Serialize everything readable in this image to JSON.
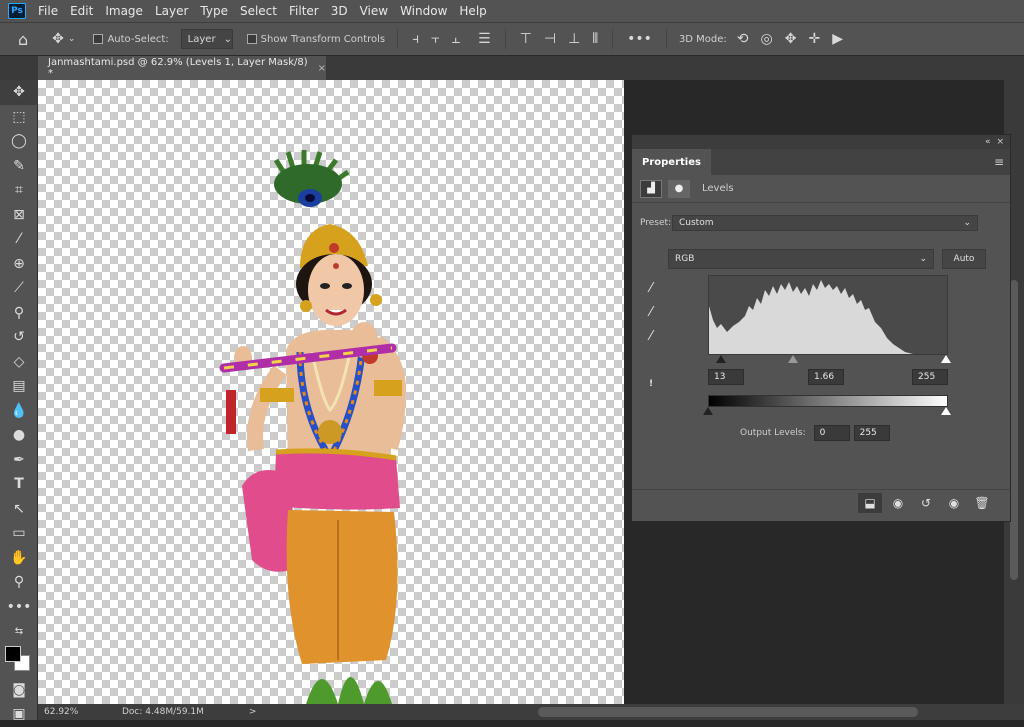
{
  "app": {
    "logo": "Ps"
  },
  "menu": [
    "File",
    "Edit",
    "Image",
    "Layer",
    "Type",
    "Select",
    "Filter",
    "3D",
    "View",
    "Window",
    "Help"
  ],
  "options": {
    "auto_select_label": "Auto-Select:",
    "auto_select_value": "Layer",
    "transform_label": "Show Transform Controls",
    "mode_label": "3D Mode:",
    "more": "•••"
  },
  "document": {
    "tab_title": "Janmashtami.psd @ 62.9% (Levels 1, Layer Mask/8) *",
    "close": "×"
  },
  "status": {
    "zoom": "62.92%",
    "doc": "Doc: 4.48M/59.1M",
    "arrow": ">"
  },
  "properties": {
    "tab": "Properties",
    "collapse": "«",
    "close": "×",
    "menu": "≡",
    "adjustment": "Levels",
    "preset_label": "Preset:",
    "preset_value": "Custom",
    "channel": "RGB",
    "auto_button": "Auto",
    "input_black": "13",
    "input_gamma": "1.66",
    "input_white": "255",
    "output_label": "Output Levels:",
    "output_black": "0",
    "output_white": "255",
    "warning": "!"
  },
  "colors": {
    "accent": "#31a8ff",
    "panel": "#535353",
    "canvas_bg": "#282828"
  }
}
